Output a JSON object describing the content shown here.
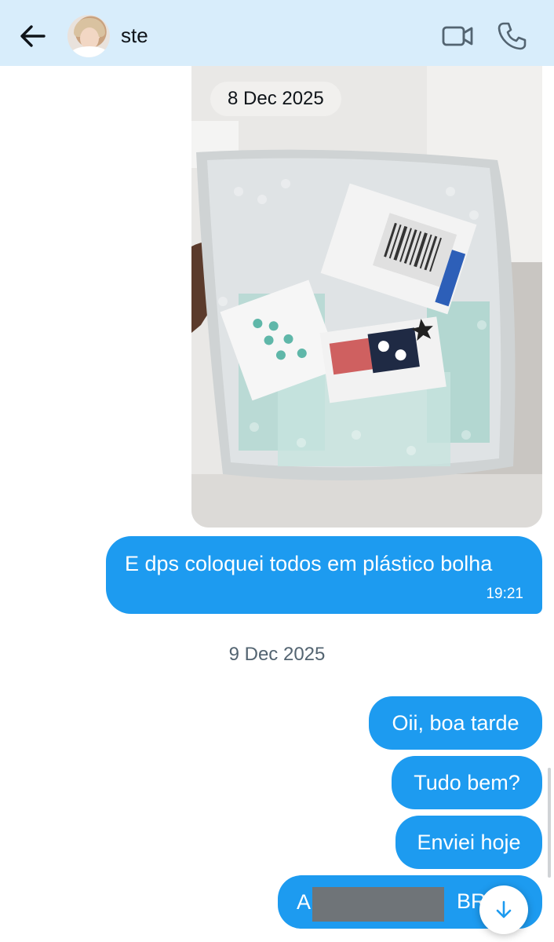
{
  "header": {
    "contact_name": "ste",
    "back_icon": "arrow-left-icon",
    "video_icon": "video-camera-icon",
    "call_icon": "phone-icon",
    "background": "#d8edfb"
  },
  "photo": {
    "date_chip": "8 Dec 2025"
  },
  "messages": [
    {
      "text": "E dps coloquei todos em plástico bolha",
      "time": "19:21"
    },
    {
      "text": "Oii, boa tarde"
    },
    {
      "text": "Tudo bem?"
    },
    {
      "text": "Enviei hoje"
    },
    {
      "text_start": "A",
      "text_end": "BR",
      "redacted": true
    }
  ],
  "date_separator": "9 Dec 2025",
  "colors": {
    "bubble": "#1d9bf0",
    "bubble_text": "#ffffff",
    "muted_text": "#536471"
  },
  "scroll_down_icon": "arrow-down-icon"
}
